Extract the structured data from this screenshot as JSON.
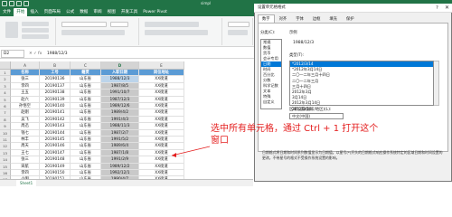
{
  "window": {
    "title": "simpl"
  },
  "ribbon_tabs": [
    "文件",
    "开始",
    "插入",
    "页面布局",
    "公式",
    "数据",
    "审阅",
    "视图",
    "开发工具",
    "Power Pivot"
  ],
  "active_ribbon_tab": 1,
  "formula_bar": {
    "name_box": "D2",
    "fx_icons": "✕ ✓ fx",
    "value": "1988/12/3"
  },
  "columns": [
    "A",
    "B",
    "C",
    "D",
    "E"
  ],
  "selected_column": "D",
  "table": {
    "headers": [
      "名称",
      "工号",
      "籍贯",
      "入职日期",
      "岗位地址"
    ],
    "rows": [
      [
        "张三",
        "20190136",
        "山东省",
        "1988/12/3",
        "XX街道"
      ],
      [
        "李四",
        "20190137",
        "山东省",
        "1987/8/5",
        "XX街道"
      ],
      [
        "王五",
        "20190138",
        "山东省",
        "1991/10/7",
        "XX街道"
      ],
      [
        "赵六",
        "20190139",
        "山东省",
        "1987/12/3",
        "XX街道"
      ],
      [
        "孙悟空",
        "20190140",
        "山东省",
        "1989/12/6",
        "XX街道"
      ],
      [
        "赵刚",
        "20190141",
        "山东省",
        "1989/4/2",
        "XX街道"
      ],
      [
        "吴飞",
        "20190142",
        "山东省",
        "1991/4/3",
        "XX街道"
      ],
      [
        "周迅",
        "20190143",
        "山东省",
        "1988/11/3",
        "XX街道"
      ],
      [
        "钱七",
        "20190144",
        "山东省",
        "1987/2/7",
        "XX街道"
      ],
      [
        "林丰",
        "20190145",
        "山东省",
        "1991/5/2",
        "XX街道"
      ],
      [
        "周天",
        "20190146",
        "山东省",
        "1989/6/4",
        "XX街道"
      ],
      [
        "王七",
        "20190147",
        "山东省",
        "1987/1/8",
        "XX街道"
      ],
      [
        "张三",
        "20190148",
        "山东省",
        "1991/2/9",
        "XX街道"
      ],
      [
        "宋航",
        "20190149",
        "山东省",
        "1989/12/2",
        "XX街道"
      ],
      [
        "李四",
        "20190150",
        "山东省",
        "1992/12/1",
        "XX街道"
      ],
      [
        "小明",
        "20190151",
        "山东省",
        "1990/4/7",
        "XX街道"
      ]
    ]
  },
  "dialog": {
    "title": "设置单元格格式",
    "help": "?",
    "close": "✕",
    "tabs": [
      "数字",
      "对齐",
      "字体",
      "边框",
      "填充",
      "保护"
    ],
    "active_tab": 0,
    "category_label": "分类(C):",
    "categories": [
      "常规",
      "数值",
      "货币",
      "会计专用",
      "日期",
      "时间",
      "百分比",
      "分数",
      "科学记数",
      "文本",
      "特殊",
      "自定义"
    ],
    "selected_category": 4,
    "sample_label": "示例",
    "sample_value": "1988/12/3",
    "type_label": "类型(T):",
    "types": [
      "*2012/3/14",
      "*2012年3月14日",
      "二〇一二年三月十四日",
      "二〇一二年三月",
      "三月十四日",
      "2012年3月",
      "3月14日",
      "2012年3月14日",
      "2012/3/14"
    ],
    "selected_type": 0,
    "locale_label": "区域设置(国家/地区)(L):",
    "locale_value": "中文(中国)",
    "description": "日期格式将日期和时间系列数值显示为日期值。以星号(*)开头的日期格式响应操作系统特定的区域日期和时间设置的更改。不带星号的格式不受操作系统设置的影响。"
  },
  "annotation": "选中所有单元格，通过 Ctrl + 1 打开这个窗口",
  "sheet_tab": "Sheet1"
}
